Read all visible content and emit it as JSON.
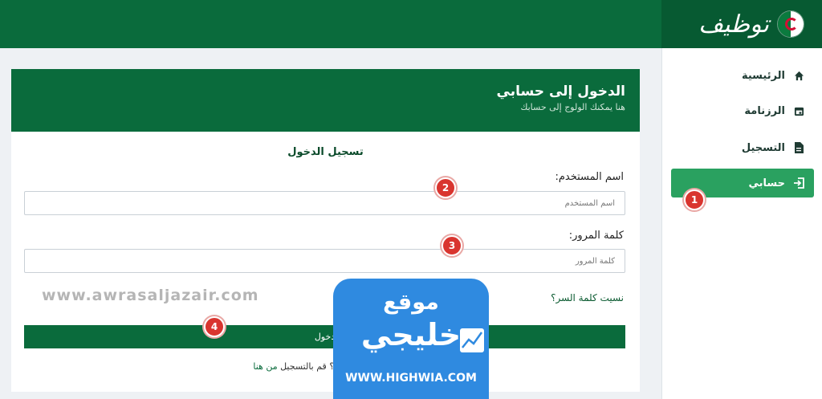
{
  "header": {
    "logo_text": "توظيف",
    "flag_icon": "algeria-flag-icon"
  },
  "sidebar": {
    "items": [
      {
        "label": "الرئيسية",
        "icon": "home-icon"
      },
      {
        "label": "الرزنامة",
        "icon": "calendar-icon"
      },
      {
        "label": "التسجيل",
        "icon": "document-icon"
      },
      {
        "label": "حسابي",
        "icon": "login-icon",
        "active": true
      }
    ],
    "active_color": "#2aa160"
  },
  "card": {
    "title": "الدخول إلى حسابي",
    "subtitle": "هنا يمكنك الولوج إلى حسابك",
    "login_heading": "تسجيل الدخول",
    "username": {
      "label": "اسم المستخدم:",
      "placeholder": "اسم المستخدم",
      "value": ""
    },
    "password": {
      "label": "كلمة المرور:",
      "placeholder": "كلمة المرور",
      "value": ""
    },
    "forgot": "نسيت كلمة السر؟",
    "submit": "دخول",
    "register_hint": "ليس لديك حساب؟ قم بالتسجيل",
    "register_link": "من هنا"
  },
  "annotations": {
    "steps": [
      "1",
      "2",
      "3",
      "4"
    ],
    "color": "#d9352f"
  },
  "watermarks": {
    "site": "www.awrasaljazair.com",
    "overlay_top": "موقع",
    "overlay_brand": "خليجي",
    "overlay_url": "WWW.HIGHWIA.COM"
  },
  "colors": {
    "primary": "#0a6b3c",
    "header_dark": "#075a32",
    "background": "#eef1f4"
  }
}
